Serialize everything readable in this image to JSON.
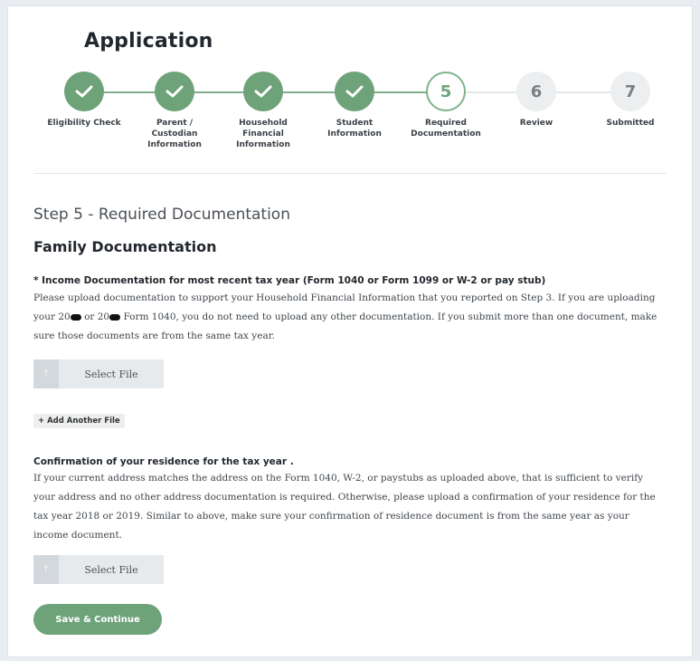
{
  "app_title": "Application",
  "colors": {
    "accent_green": "#6ea37a",
    "inactive_gray": "#eceeef"
  },
  "steps": [
    {
      "number": "1",
      "label": "Eligibility Check",
      "state": "done",
      "icon": "check-icon"
    },
    {
      "number": "2",
      "label": "Parent / Custodian Information",
      "state": "done",
      "icon": "check-icon"
    },
    {
      "number": "3",
      "label": "Household Financial Information",
      "state": "done",
      "icon": "check-icon"
    },
    {
      "number": "4",
      "label": "Student Information",
      "state": "done",
      "icon": "check-icon"
    },
    {
      "number": "5",
      "label": "Required Documentation",
      "state": "active"
    },
    {
      "number": "6",
      "label": "Review",
      "state": "todo"
    },
    {
      "number": "7",
      "label": "Submitted",
      "state": "todo"
    }
  ],
  "step_heading": "Step 5 - Required Documentation",
  "section_title": "Family Documentation",
  "income": {
    "title": "* Income Documentation for most recent tax year (Form 1040 or Form 1099 or W-2 or pay stub)",
    "text_1": "Please upload documentation to support your Household Financial Information that you reported on Step 3. If you are uploading your 20",
    "text_2": " or 20",
    "text_3": " Form 1040, you do not need to upload any other documentation. If you submit more than one document, make sure those documents are from the same tax year.",
    "select_file_label": "Select File",
    "add_file_label": "+ Add Another File"
  },
  "residence": {
    "title": "Confirmation of your residence for the tax year .",
    "text": "If your current address matches the address on the Form 1040, W-2, or paystubs as uploaded above, that is sufficient to verify your address and no other address documentation is required. Otherwise, please upload a confirmation of your residence for the tax year 2018 or 2019. Similar to above, make sure your confirmation of residence document is from the same year as your income document.",
    "select_file_label": "Select File"
  },
  "save_label": "Save & Continue"
}
